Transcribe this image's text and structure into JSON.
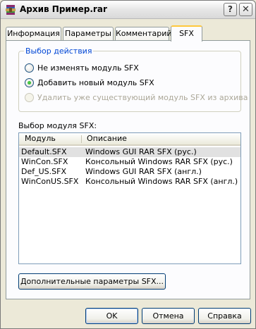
{
  "window": {
    "title": "Архив Пример.rar",
    "help_label": "?",
    "close_label": "✕"
  },
  "tabs": [
    {
      "label": "Информация"
    },
    {
      "label": "Параметры"
    },
    {
      "label": "Комментарий"
    },
    {
      "label": "SFX",
      "active": true
    }
  ],
  "action_group": {
    "title": "Выбор действия",
    "options": [
      {
        "label": "Не изменять модуль SFX",
        "checked": false,
        "disabled": false
      },
      {
        "label": "Добавить новый модуль SFX",
        "checked": true,
        "disabled": false
      },
      {
        "label": "Удалить уже существующий модуль SFX из архива",
        "checked": false,
        "disabled": true
      }
    ]
  },
  "module_list": {
    "caption": "Выбор модуля SFX:",
    "columns": [
      "Модуль",
      "Описание"
    ],
    "rows": [
      {
        "module": "Default.SFX",
        "description": "Windows GUI RAR SFX (рус.)",
        "selected": true
      },
      {
        "module": "WinCon.SFX",
        "description": "Консольный Windows RAR SFX (рус.)",
        "selected": false
      },
      {
        "module": "Def_US.SFX",
        "description": "Windows GUI RAR SFX (англ.)",
        "selected": false
      },
      {
        "module": "WinConUS.SFX",
        "description": "Консольный Windows RAR SFX (англ.)",
        "selected": false
      }
    ]
  },
  "advanced_button": "Дополнительные параметры SFX...",
  "footer": {
    "ok": "OK",
    "cancel": "Отмена",
    "help": "Справка"
  },
  "colors": {
    "group_title": "#0046d5",
    "tab_highlight": "#ffc83c",
    "selected_row": "#e1e1e1"
  }
}
